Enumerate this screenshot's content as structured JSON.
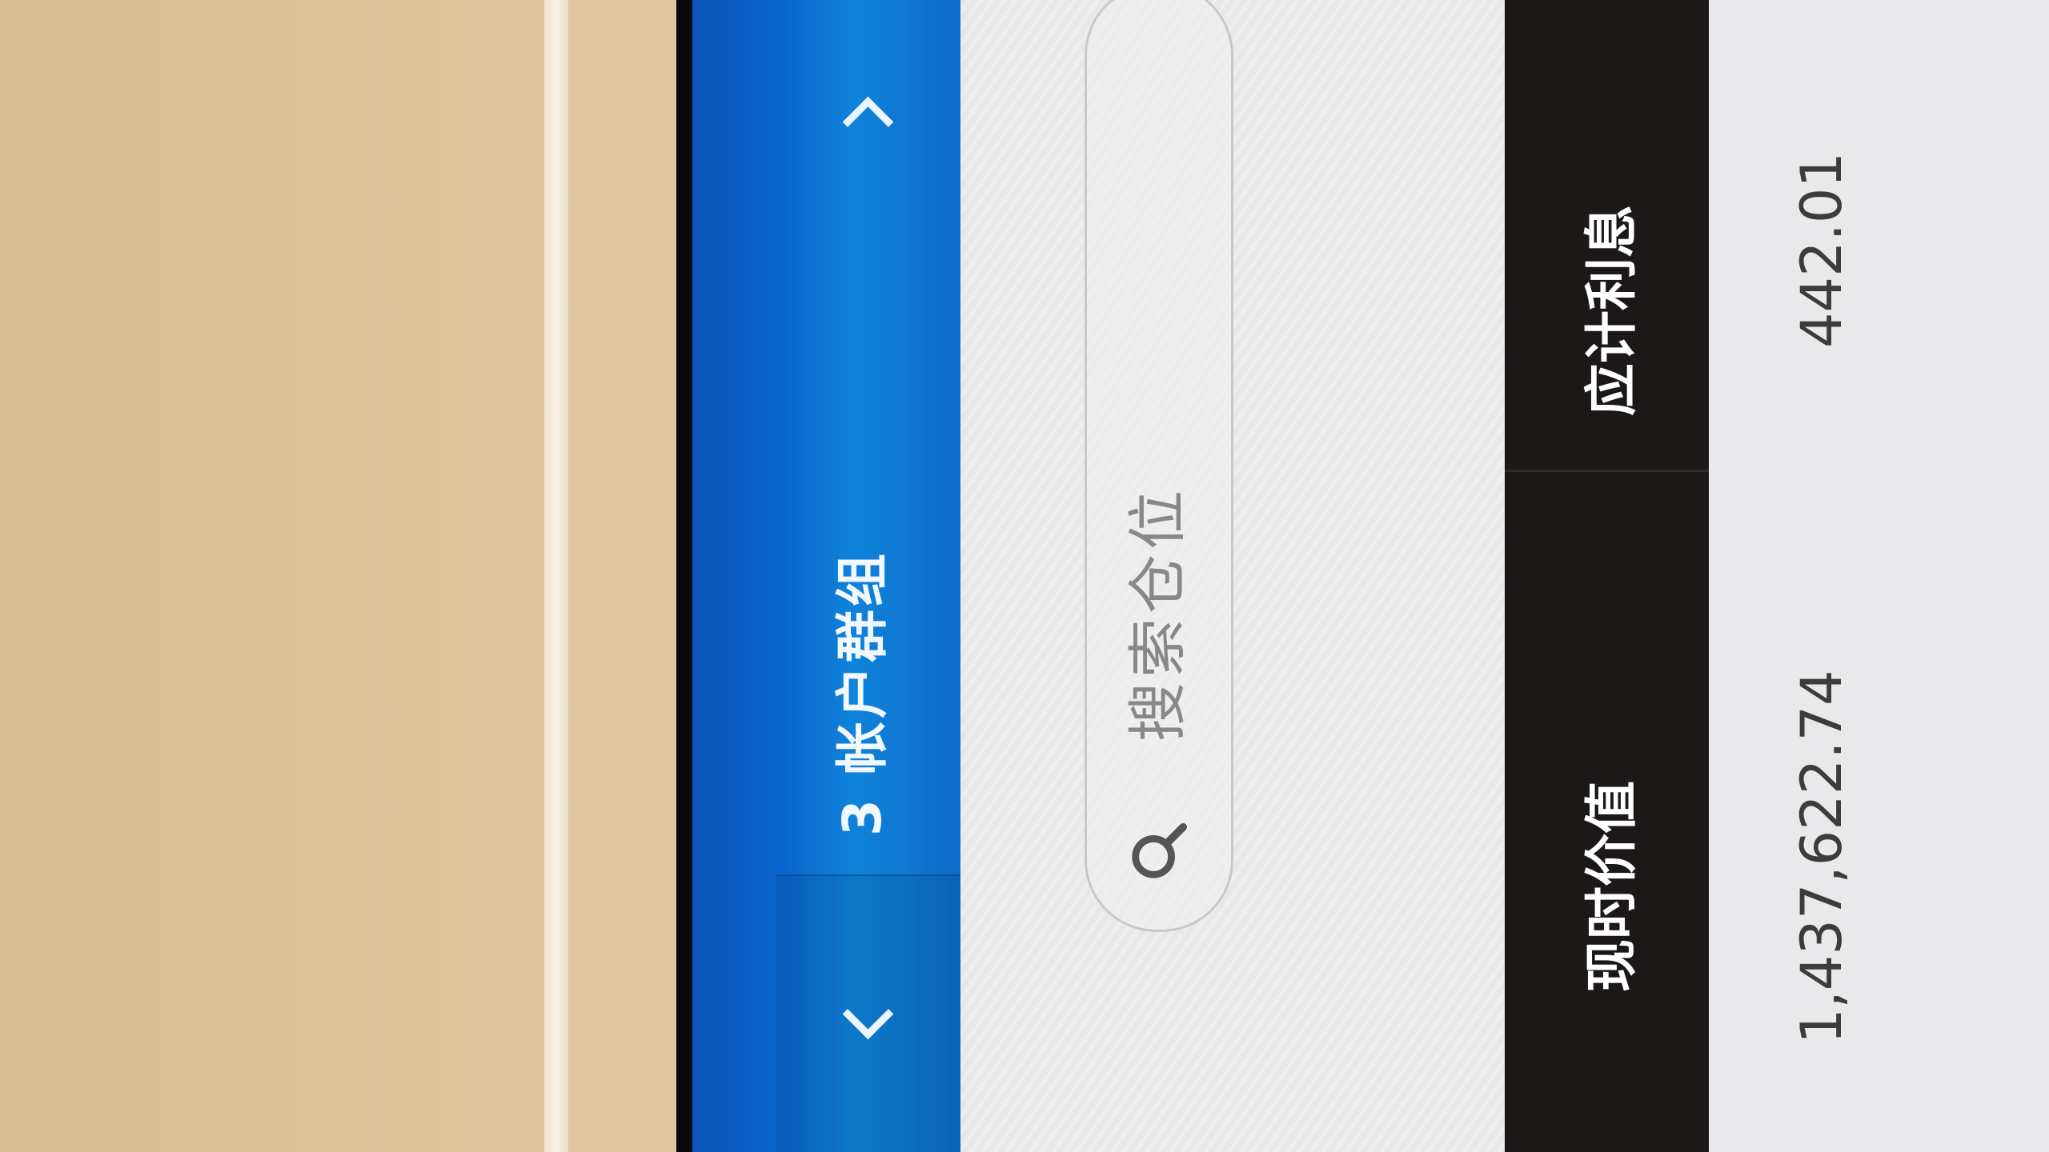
{
  "header": {
    "group_title": "3 帐户群组"
  },
  "search": {
    "placeholder": "搜索仓位"
  },
  "table": {
    "columns": [
      "现时价值",
      "应计利息"
    ],
    "rows": [
      {
        "current_value": "1,437,622.74",
        "accrued_interest": "442.01"
      }
    ]
  },
  "icons": {
    "prev": "chevron-left-icon",
    "next": "chevron-right-icon",
    "search": "search-icon"
  },
  "colors": {
    "header_blue": "#0a66cd",
    "table_header": "#1b1817"
  }
}
